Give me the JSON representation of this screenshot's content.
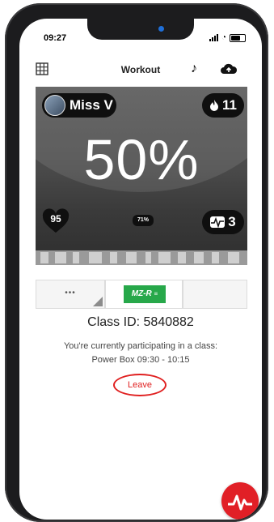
{
  "status_bar": {
    "time": "09:27",
    "icons": [
      "location-arrow-icon",
      "signal-icon",
      "wifi-icon",
      "battery-icon"
    ]
  },
  "app_bar": {
    "title": "Workout",
    "icons": [
      "grid-icon",
      "music-note-icon",
      "cloud-upload-icon"
    ]
  },
  "tile": {
    "user_name": "Miss V",
    "flame_count": "11",
    "effort_percent": "50%",
    "heart_rate": "95",
    "small_percent": "71%",
    "zone_count": "3"
  },
  "tabs": {
    "more_label": "•••",
    "logo_text": "MZ-R"
  },
  "class_info": {
    "class_id": "Class ID: 5840882",
    "participating_text": "You're currently participating in a class:",
    "class_name": "Power Box 09:30 - 10:15",
    "leave_label": "Leave"
  },
  "colors": {
    "accent_red": "#e11f26",
    "mzr_green": "#27a84a",
    "tile_dark": "#4a4a4a"
  }
}
